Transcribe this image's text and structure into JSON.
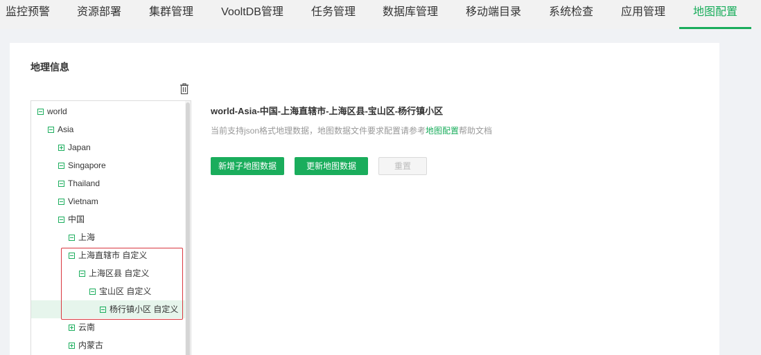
{
  "nav": {
    "tabs": [
      {
        "label": "监控预警",
        "active": false
      },
      {
        "label": "资源部署",
        "active": false
      },
      {
        "label": "集群管理",
        "active": false
      },
      {
        "label": "VooltDB管理",
        "active": false
      },
      {
        "label": "任务管理",
        "active": false
      },
      {
        "label": "数据库管理",
        "active": false
      },
      {
        "label": "移动端目录",
        "active": false
      },
      {
        "label": "系统检查",
        "active": false
      },
      {
        "label": "应用管理",
        "active": false
      },
      {
        "label": "地图配置",
        "active": true
      }
    ]
  },
  "panel": {
    "title": "地理信息",
    "delete_icon": "trash-icon"
  },
  "tree": {
    "nodes": [
      {
        "label": "world",
        "expanded": true
      },
      {
        "label": "Asia",
        "expanded": true
      },
      {
        "label": "Japan",
        "expanded": false
      },
      {
        "label": "Singapore",
        "expanded": true
      },
      {
        "label": "Thailand",
        "expanded": true
      },
      {
        "label": "Vietnam",
        "expanded": true
      },
      {
        "label": "中国",
        "expanded": true
      },
      {
        "label": "上海",
        "expanded": true
      },
      {
        "label": "上海直辖市 自定义",
        "expanded": true
      },
      {
        "label": "上海区县 自定义",
        "expanded": true
      },
      {
        "label": "宝山区 自定义",
        "expanded": true
      },
      {
        "label": "杨行镇小区 自定义",
        "expanded": true,
        "selected": true
      },
      {
        "label": "云南",
        "expanded": false
      },
      {
        "label": "内蒙古",
        "expanded": false
      }
    ]
  },
  "detail": {
    "path": "world-Asia-中国-上海直辖市-上海区县-宝山区-杨行镇小区",
    "hint_prefix": "当前支持json格式地理数据，地图数据文件要求配置请参考",
    "hint_link": "地图配置",
    "hint_suffix": "帮助文档"
  },
  "buttons": {
    "add_child": "新增子地图数据",
    "update": "更新地图数据",
    "reset": "重置"
  },
  "colors": {
    "accent": "#1aad5c",
    "highlight_border": "#d9363e"
  }
}
